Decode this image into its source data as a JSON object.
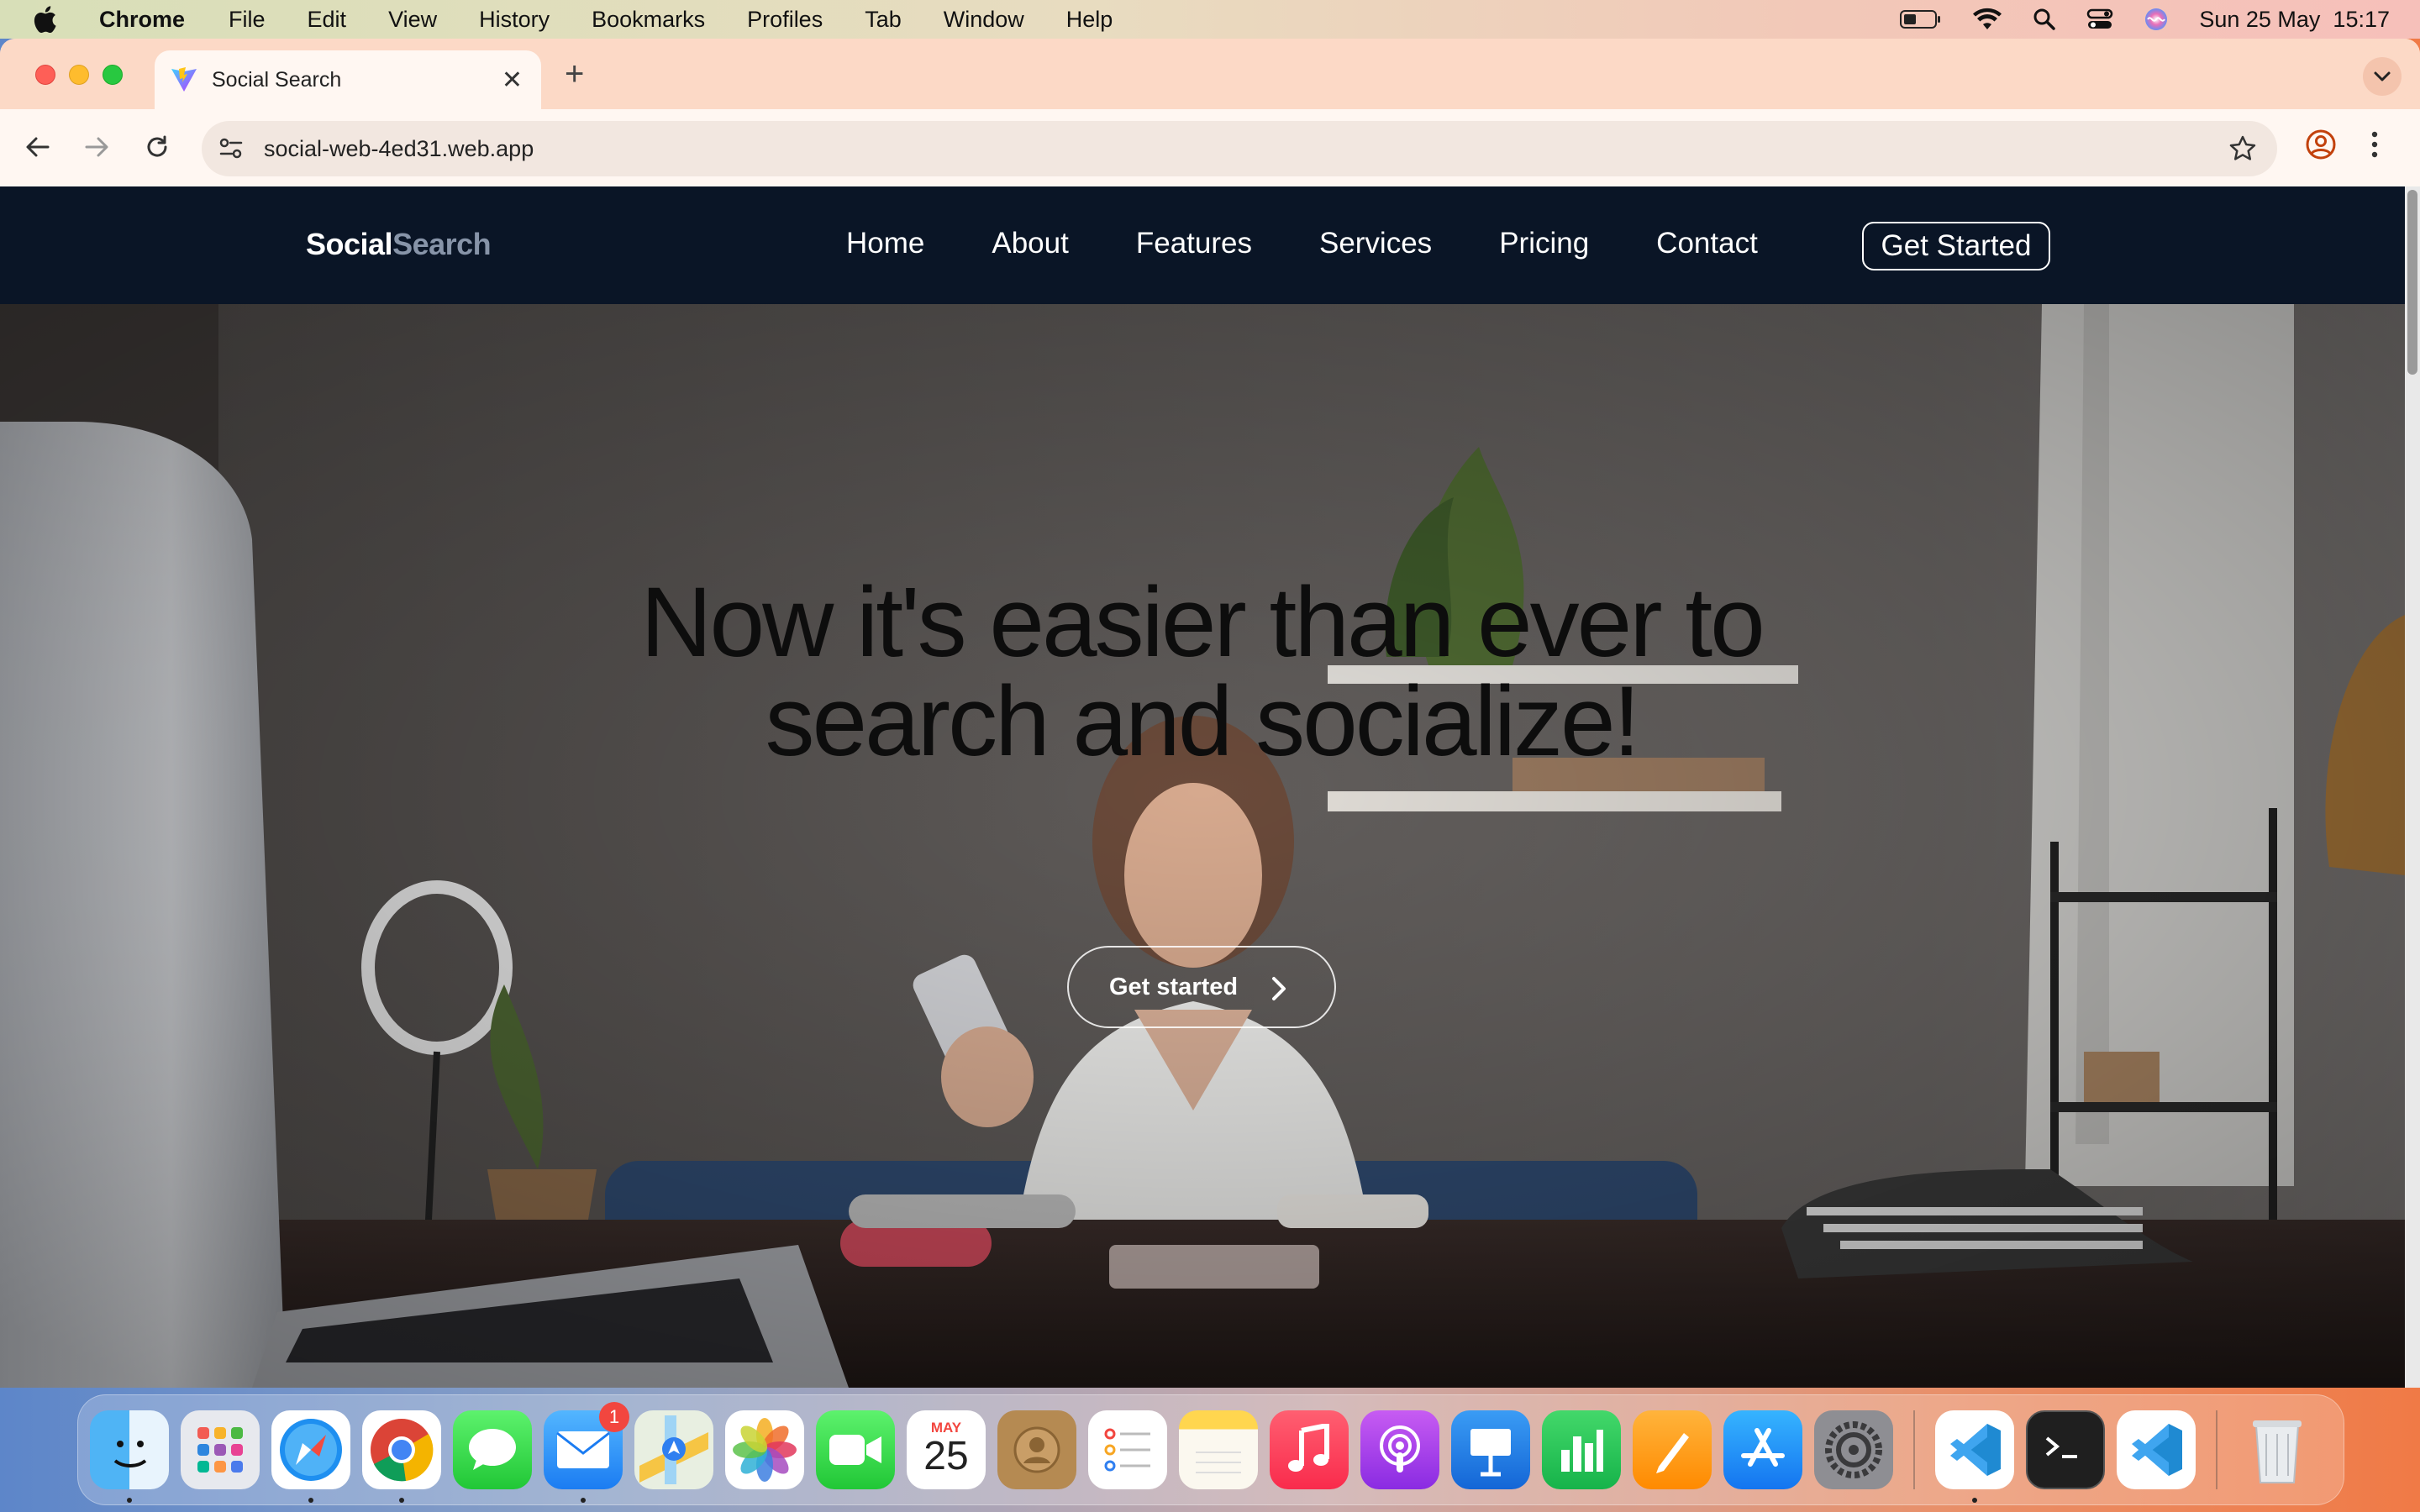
{
  "menubar": {
    "app_name": "Chrome",
    "items": [
      "File",
      "Edit",
      "View",
      "History",
      "Bookmarks",
      "Profiles",
      "Tab",
      "Window",
      "Help"
    ],
    "datetime": "Sun 25 May  15:17"
  },
  "browser": {
    "tab_title": "Social Search",
    "url": "social-web-4ed31.web.app"
  },
  "site": {
    "brand_part1": "Social",
    "brand_part2": "Search",
    "nav": [
      "Home",
      "About",
      "Features",
      "Services",
      "Pricing",
      "Contact"
    ],
    "cta_label": "Get Started",
    "headline_line1": "Now it's easier than ever to",
    "headline_line2": "search and socialize!",
    "hero_button": "Get started"
  },
  "dock": {
    "mail_badge": "1",
    "calendar_month": "MAY",
    "calendar_day": "25"
  },
  "colors": {
    "nav_bg": "#0a1526",
    "brand_accent": "#8794a8"
  }
}
